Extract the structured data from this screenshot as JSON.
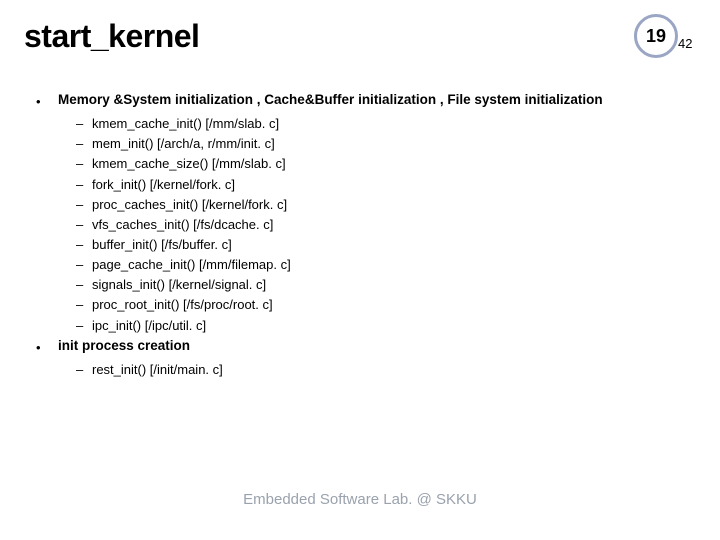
{
  "header": {
    "title": "start_kernel",
    "page_current": "19",
    "page_total": "42"
  },
  "sections": [
    {
      "heading": "Memory &System initialization , Cache&Buffer initialization , File system initialization",
      "items": [
        "kmem_cache_init() [/mm/slab. c]",
        "mem_init() [/arch/a, r/mm/init. c]",
        "kmem_cache_size() [/mm/slab. c]",
        "fork_init() [/kernel/fork. c]",
        "proc_caches_init() [/kernel/fork. c]",
        "vfs_caches_init() [/fs/dcache. c]",
        "buffer_init() [/fs/buffer. c]",
        "page_cache_init() [/mm/filemap. c]",
        "signals_init() [/kernel/signal. c]",
        "proc_root_init() [/fs/proc/root. c]",
        "ipc_init() [/ipc/util. c]"
      ]
    },
    {
      "heading": "init process creation",
      "items": [
        "rest_init() [/init/main. c]"
      ]
    }
  ],
  "footer": "Embedded Software Lab. @ SKKU"
}
